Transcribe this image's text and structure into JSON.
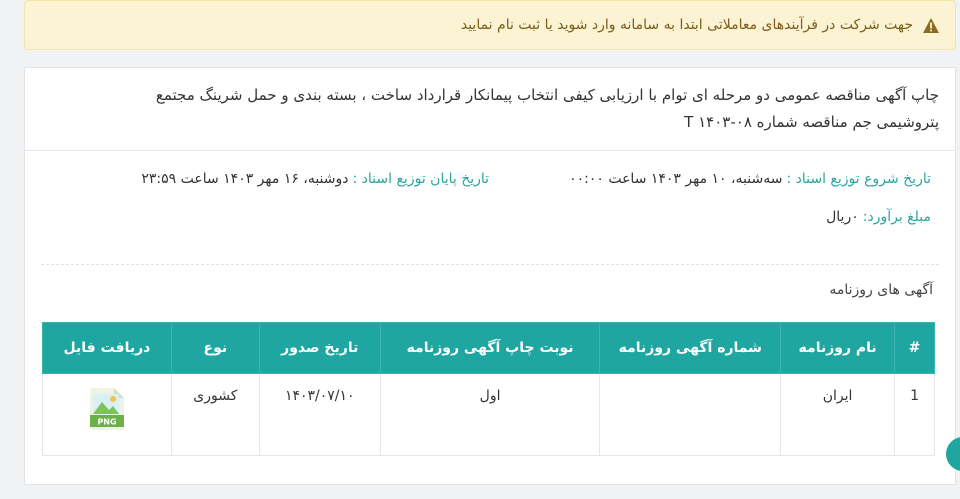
{
  "alert": {
    "text": "جهت شرکت در فرآیندهای معاملاتی ابتدا به سامانه وارد شوید یا ثبت نام نمایید"
  },
  "tender": {
    "title_line1": "چاپ آگهی مناقصه عمومی دو مرحله ای توام با ارزیابی کیفی انتخاب پیمانکار قرارداد ساخت ، بسته بندی و حمل شرینگ مجتمع",
    "title_line2": "پتروشیمی جم مناقصه شماره ۰۸-۱۴۰۳ T",
    "start_label": "تاریخ شروع توزیع اسناد :",
    "start_value": "سه‌شنبه، ۱۰ مهر ۱۴۰۳ ساعت ۰۰:۰۰",
    "end_label": "تاریخ پایان توزیع اسناد :",
    "end_value": "دوشنبه، ۱۶ مهر ۱۴۰۳ ساعت ۲۳:۵۹",
    "budget_label": "مبلغ برآورد:",
    "budget_value": "۰ریال"
  },
  "newspaper_section": {
    "title": "آگهی های روزنامه",
    "columns": [
      "#",
      "نام روزنامه",
      "شماره آگهی روزنامه",
      "نوبت چاپ آگهی روزنامه",
      "تاریخ صدور",
      "نوع",
      "دریافت فایل"
    ],
    "rows": [
      {
        "index": "1",
        "name": "ایران",
        "number": "",
        "print_turn": "اول",
        "issue_date": "۱۴۰۳/۰۷/۱۰",
        "type": "کشوری",
        "file_label": "PNG"
      }
    ]
  },
  "colors": {
    "accent": "#1fa6a1",
    "alert_bg": "#fcf3d4",
    "alert_text": "#7a5d1a"
  },
  "icons": {
    "alert": "warning-icon",
    "file": "png-file-icon"
  }
}
